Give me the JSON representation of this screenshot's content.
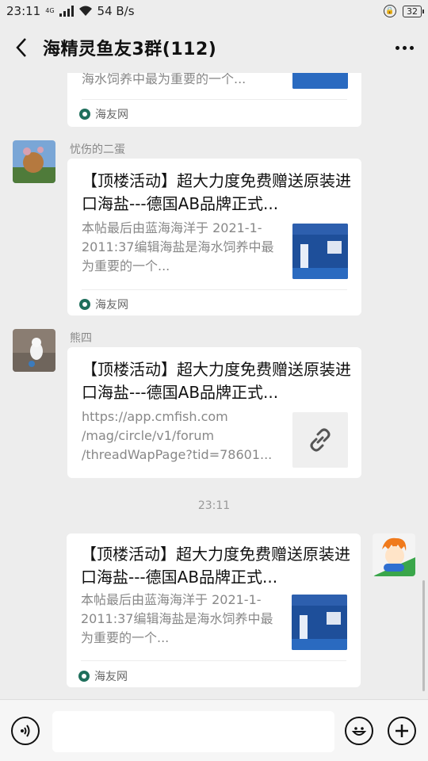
{
  "status_bar": {
    "time": "23:11",
    "network": "4G",
    "speed": "54 B/s",
    "battery": "32"
  },
  "header": {
    "title": "海精灵鱼友3群(112)"
  },
  "messages": [
    {
      "desc_tail": "海水饲养中最为重要的一个...",
      "source": "海友网"
    },
    {
      "sender": "忧伤的二蛋",
      "title": "【顶楼活动】超大力度免费赠送原装进口海盐---德国AB品牌正式...",
      "desc": "本帖最后由蓝海海洋于 2021-1-2011:37编辑海盐是海水饲养中最为重要的一个...",
      "source": "海友网"
    },
    {
      "sender": "熊四",
      "title": "【顶楼活动】超大力度免费赠送原装进口海盐---德国AB品牌正式...",
      "desc": "https://app.cmfish.com /mag/circle/v1/forum /threadWapPage?tid=78601..."
    },
    {
      "timestamp": "23:11"
    },
    {
      "title": "【顶楼活动】超大力度免费赠送原装进口海盐---德国AB品牌正式...",
      "desc": "本帖最后由蓝海海洋于 2021-1-2011:37编辑海盐是海水饲养中最为重要的一个...",
      "source": "海友网"
    }
  ],
  "icons": {
    "back": "back-arrow-icon",
    "more": "more-dots-icon",
    "voice": "voice-icon",
    "emoji": "emoji-icon",
    "plus": "plus-icon",
    "link": "link-icon"
  },
  "colors": {
    "background": "#ededed",
    "card": "#ffffff",
    "thumb_blue": "#1e4f9a"
  }
}
